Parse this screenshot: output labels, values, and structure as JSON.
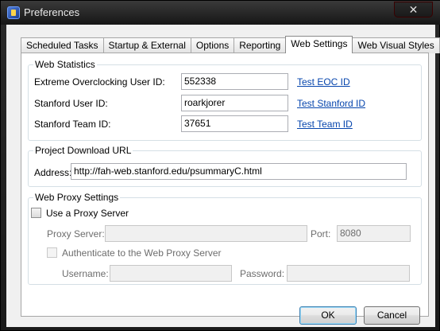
{
  "window": {
    "title": "Preferences",
    "close_glyph": "✕"
  },
  "tabs": [
    {
      "label": "Scheduled Tasks"
    },
    {
      "label": "Startup & External"
    },
    {
      "label": "Options"
    },
    {
      "label": "Reporting"
    },
    {
      "label": "Web Settings",
      "active": true
    },
    {
      "label": "Web Visual Styles"
    }
  ],
  "web_statistics": {
    "title": "Web Statistics",
    "eoc_label": "Extreme Overclocking User ID:",
    "eoc_value": "552338",
    "eoc_link": "Test EOC ID",
    "stanford_user_label": "Stanford User ID:",
    "stanford_user_value": "roarkjorer",
    "stanford_user_link": "Test Stanford ID",
    "stanford_team_label": "Stanford Team ID:",
    "stanford_team_value": "37651",
    "stanford_team_link": "Test Team ID"
  },
  "project_download": {
    "title": "Project Download URL",
    "address_label": "Address:",
    "address_value": "http://fah-web.stanford.edu/psummaryC.html"
  },
  "proxy": {
    "title": "Web Proxy Settings",
    "use_proxy_label": "Use a Proxy Server",
    "use_proxy_checked": false,
    "server_label": "Proxy Server:",
    "server_value": "",
    "port_label": "Port:",
    "port_value": "8080",
    "auth_label": "Authenticate to the Web Proxy Server",
    "auth_checked": false,
    "username_label": "Username:",
    "username_value": "",
    "password_label": "Password:",
    "password_value": ""
  },
  "buttons": {
    "ok": "OK",
    "cancel": "Cancel"
  },
  "icons": {
    "app": "folding-app-icon",
    "close": "close-icon"
  },
  "colors": {
    "link": "#0645ad",
    "titlebar": "#1a1a1a",
    "dialog_bg": "#f0f0f0"
  }
}
